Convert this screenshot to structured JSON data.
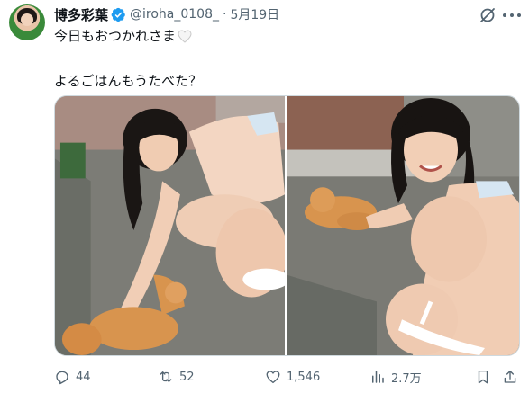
{
  "author": {
    "display_name": "博多彩葉",
    "handle": "@iroha_0108_",
    "separator": "·",
    "date": "5月19日",
    "verified": true,
    "avatar_icon": "profile-photo"
  },
  "tweet": {
    "line1": "今日もおつかれさま",
    "line1_emoji": "white-heart",
    "line2": "よるごはんもうたべた？"
  },
  "media": {
    "count": 2,
    "icons": [
      "photo-girl-crouching-with-cat",
      "photo-girl-smiling-with-cat"
    ]
  },
  "actions": {
    "reply_count": "44",
    "repost_count": "52",
    "like_count": "1,546",
    "views_count": "2.7万"
  },
  "colors": {
    "text_primary": "#0f1419",
    "text_secondary": "#536471",
    "verified_blue": "#1d9bf0",
    "border": "#cfd9de"
  }
}
